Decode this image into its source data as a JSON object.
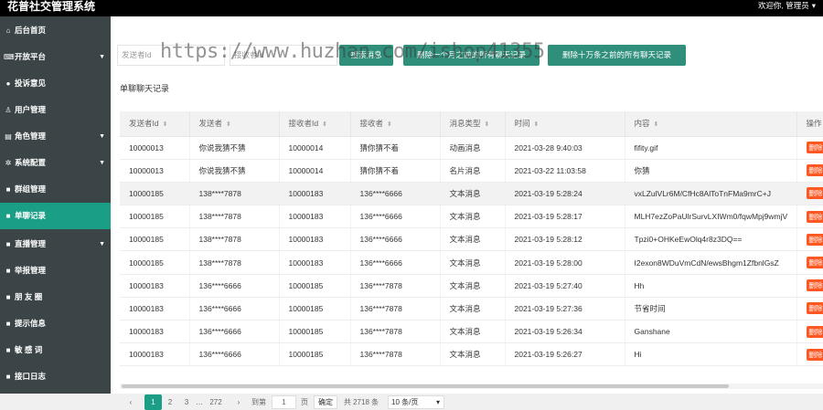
{
  "header": {
    "title": "花普社交管理系统",
    "welcome": "欢迎你, 管理员"
  },
  "sidebar": {
    "items": [
      {
        "icon": "⌂",
        "label": "后台首页",
        "arrow": false
      },
      {
        "icon": "⌨",
        "label": "开放平台",
        "arrow": true
      },
      {
        "icon": "●",
        "label": "投诉意见",
        "arrow": false
      },
      {
        "icon": "♙",
        "label": "用户管理",
        "arrow": false
      },
      {
        "icon": "▤",
        "label": "角色管理",
        "arrow": true
      },
      {
        "icon": "✲",
        "label": "系统配置",
        "arrow": true
      },
      {
        "icon": "■",
        "label": "群组管理",
        "arrow": false
      },
      {
        "icon": "■",
        "label": "单聊记录",
        "arrow": false,
        "active": true
      },
      {
        "icon": "■",
        "label": "直播管理",
        "arrow": true
      },
      {
        "icon": "■",
        "label": "举报管理",
        "arrow": false
      },
      {
        "icon": "■",
        "label": "朋 友 圈",
        "arrow": false
      },
      {
        "icon": "■",
        "label": "提示信息",
        "arrow": false
      },
      {
        "icon": "■",
        "label": "敏 感 词",
        "arrow": false
      },
      {
        "icon": "■",
        "label": "接口日志",
        "arrow": false
      }
    ]
  },
  "search": {
    "sender_placeholder": "发送者Id",
    "receiver_placeholder": "接收者Id",
    "search_label": "搜索消息",
    "delete_month_label": "删除一个月之前的所有聊天记录",
    "delete_100k_label": "删除十万条之前的所有聊天记录"
  },
  "watermark": "https://www.huzhan.com/ishop41355",
  "section_title": "单聊聊天记录",
  "table": {
    "columns": [
      "发送者Id",
      "发送者",
      "接收者Id",
      "接收者",
      "消息类型",
      "时间",
      "内容",
      "操作"
    ],
    "delete_label": "删除",
    "rows": [
      {
        "sender_id": "10000013",
        "sender": "你说我猜不猜",
        "receiver_id": "10000014",
        "receiver": "猜你猜不着",
        "type": "动画消息",
        "time": "2021-03-28 9:40:03",
        "content": "fifity.gif"
      },
      {
        "sender_id": "10000013",
        "sender": "你说我猜不猜",
        "receiver_id": "10000014",
        "receiver": "猜你猜不着",
        "type": "名片消息",
        "time": "2021-03-22 11:03:58",
        "content": "你猜"
      },
      {
        "sender_id": "10000185",
        "sender": "138****7878",
        "receiver_id": "10000183",
        "receiver": "136****6666",
        "type": "文本消息",
        "time": "2021-03-19 5:28:24",
        "content": "vxLZulVLr6M/CfHc8AlToTnFMa9mrC+J",
        "highlight": true
      },
      {
        "sender_id": "10000185",
        "sender": "138****7878",
        "receiver_id": "10000183",
        "receiver": "136****6666",
        "type": "文本消息",
        "time": "2021-03-19 5:28:17",
        "content": "MLH7ezZoPaUlrSurvLXIWm0/fqwMpj9wmjV"
      },
      {
        "sender_id": "10000185",
        "sender": "138****7878",
        "receiver_id": "10000183",
        "receiver": "136****6666",
        "type": "文本消息",
        "time": "2021-03-19 5:28:12",
        "content": "Tpzi0+OHKeEwOlq4r8z3DQ=="
      },
      {
        "sender_id": "10000185",
        "sender": "138****7878",
        "receiver_id": "10000183",
        "receiver": "136****6666",
        "type": "文本消息",
        "time": "2021-03-19 5:28:00",
        "content": "I2exon8WDuVmCdN/ewsBhgm1ZfbnlGsZ"
      },
      {
        "sender_id": "10000183",
        "sender": "136****6666",
        "receiver_id": "10000185",
        "receiver": "136****7878",
        "type": "文本消息",
        "time": "2021-03-19 5:27:40",
        "content": "Hh"
      },
      {
        "sender_id": "10000183",
        "sender": "136****6666",
        "receiver_id": "10000185",
        "receiver": "136****7878",
        "type": "文本消息",
        "time": "2021-03-19 5:27:36",
        "content": "节省时间"
      },
      {
        "sender_id": "10000183",
        "sender": "136****6666",
        "receiver_id": "10000185",
        "receiver": "136****7878",
        "type": "文本消息",
        "time": "2021-03-19 5:26:34",
        "content": "Ganshane"
      },
      {
        "sender_id": "10000183",
        "sender": "136****6666",
        "receiver_id": "10000185",
        "receiver": "136****7878",
        "type": "文本消息",
        "time": "2021-03-19 5:26:27",
        "content": "Hi"
      }
    ]
  },
  "pagination": {
    "prev": "‹",
    "pages": [
      "1",
      "2",
      "3"
    ],
    "ellipsis": "…",
    "last": "272",
    "next": "›",
    "goto_label": "到第",
    "goto_value": "1",
    "page_unit": "页",
    "confirm": "确定",
    "total": "共 2718 条",
    "page_size": "10 条/页",
    "current": "1"
  }
}
